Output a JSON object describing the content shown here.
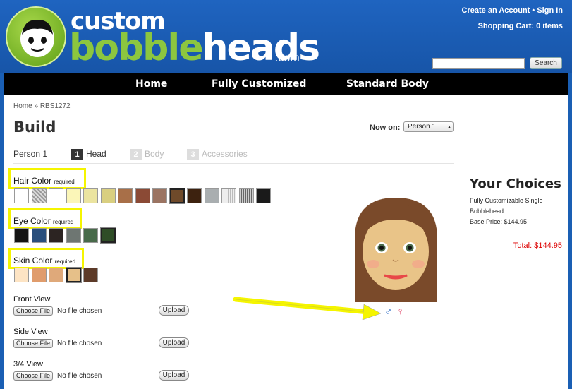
{
  "header": {
    "logo_line1": "custom",
    "logo_bobble": "bobble",
    "logo_heads": "heads",
    "logo_com": ".com",
    "create_account": "Create an Account",
    "separator": "•",
    "sign_in": "Sign In",
    "cart": "Shopping Cart: 0 items",
    "search_value": "",
    "search_button": "Search"
  },
  "nav": {
    "items": [
      {
        "label": "Home"
      },
      {
        "label": "Fully Customized"
      },
      {
        "label": "Standard Body"
      }
    ]
  },
  "breadcrumb": {
    "home": "Home",
    "sep": "»",
    "current": "RBS1272"
  },
  "page_title": "Build",
  "now_on": {
    "label": "Now on:",
    "selected": "Person 1"
  },
  "steps": {
    "person": "Person 1",
    "items": [
      {
        "num": "1",
        "label": "Head",
        "active": true
      },
      {
        "num": "2",
        "label": "Body",
        "active": false
      },
      {
        "num": "3",
        "label": "Accessories",
        "active": false
      }
    ]
  },
  "options": {
    "hair": {
      "label": "Hair Color",
      "req": "required",
      "colors": [
        "#ffffff",
        "pattern-gray",
        "#ffffff",
        "#fbf6b8",
        "#ebe4a0",
        "#d9cf80",
        "#a86f48",
        "#8b4a35",
        "#9b7462",
        "#6f4a2a",
        "#3d220f",
        "#a9aeb0",
        "pattern-light",
        "pattern-dark",
        "#1a1a1a"
      ],
      "selected_index": 9
    },
    "eye": {
      "label": "Eye Color",
      "req": "required",
      "colors": [
        "#141414",
        "#2a4f7c",
        "#2c2422",
        "#6e7672",
        "#486a4a",
        "#2f4d27"
      ],
      "selected_index": 5
    },
    "skin": {
      "label": "Skin Color",
      "req": "required",
      "colors": [
        "#fde4c4",
        "#e09c6c",
        "#dfa97a",
        "#e6c089",
        "#5c3a28"
      ],
      "selected_index": 3
    }
  },
  "uploads": [
    {
      "label": "Front View",
      "button": "Choose File",
      "status": "No file chosen",
      "upload": "Upload"
    },
    {
      "label": "Side View",
      "button": "Choose File",
      "status": "No file chosen",
      "upload": "Upload"
    },
    {
      "label": "3/4 View",
      "button": "Choose File",
      "status": "No file chosen",
      "upload": "Upload"
    }
  ],
  "gender": {
    "male": "♂",
    "female": "♀",
    "male_color": "#1b5fc0",
    "female_color": "#e05070"
  },
  "choices": {
    "title": "Your Choices",
    "product": "Fully Customizable Single Bobblehead",
    "base_price": "Base Price: $144.95",
    "total": "Total: $144.95"
  },
  "colors": {
    "brand_blue": "#1a5fb4",
    "nav_bg": "#000000",
    "highlight": "#f5f500",
    "total_red": "#dd0000"
  }
}
